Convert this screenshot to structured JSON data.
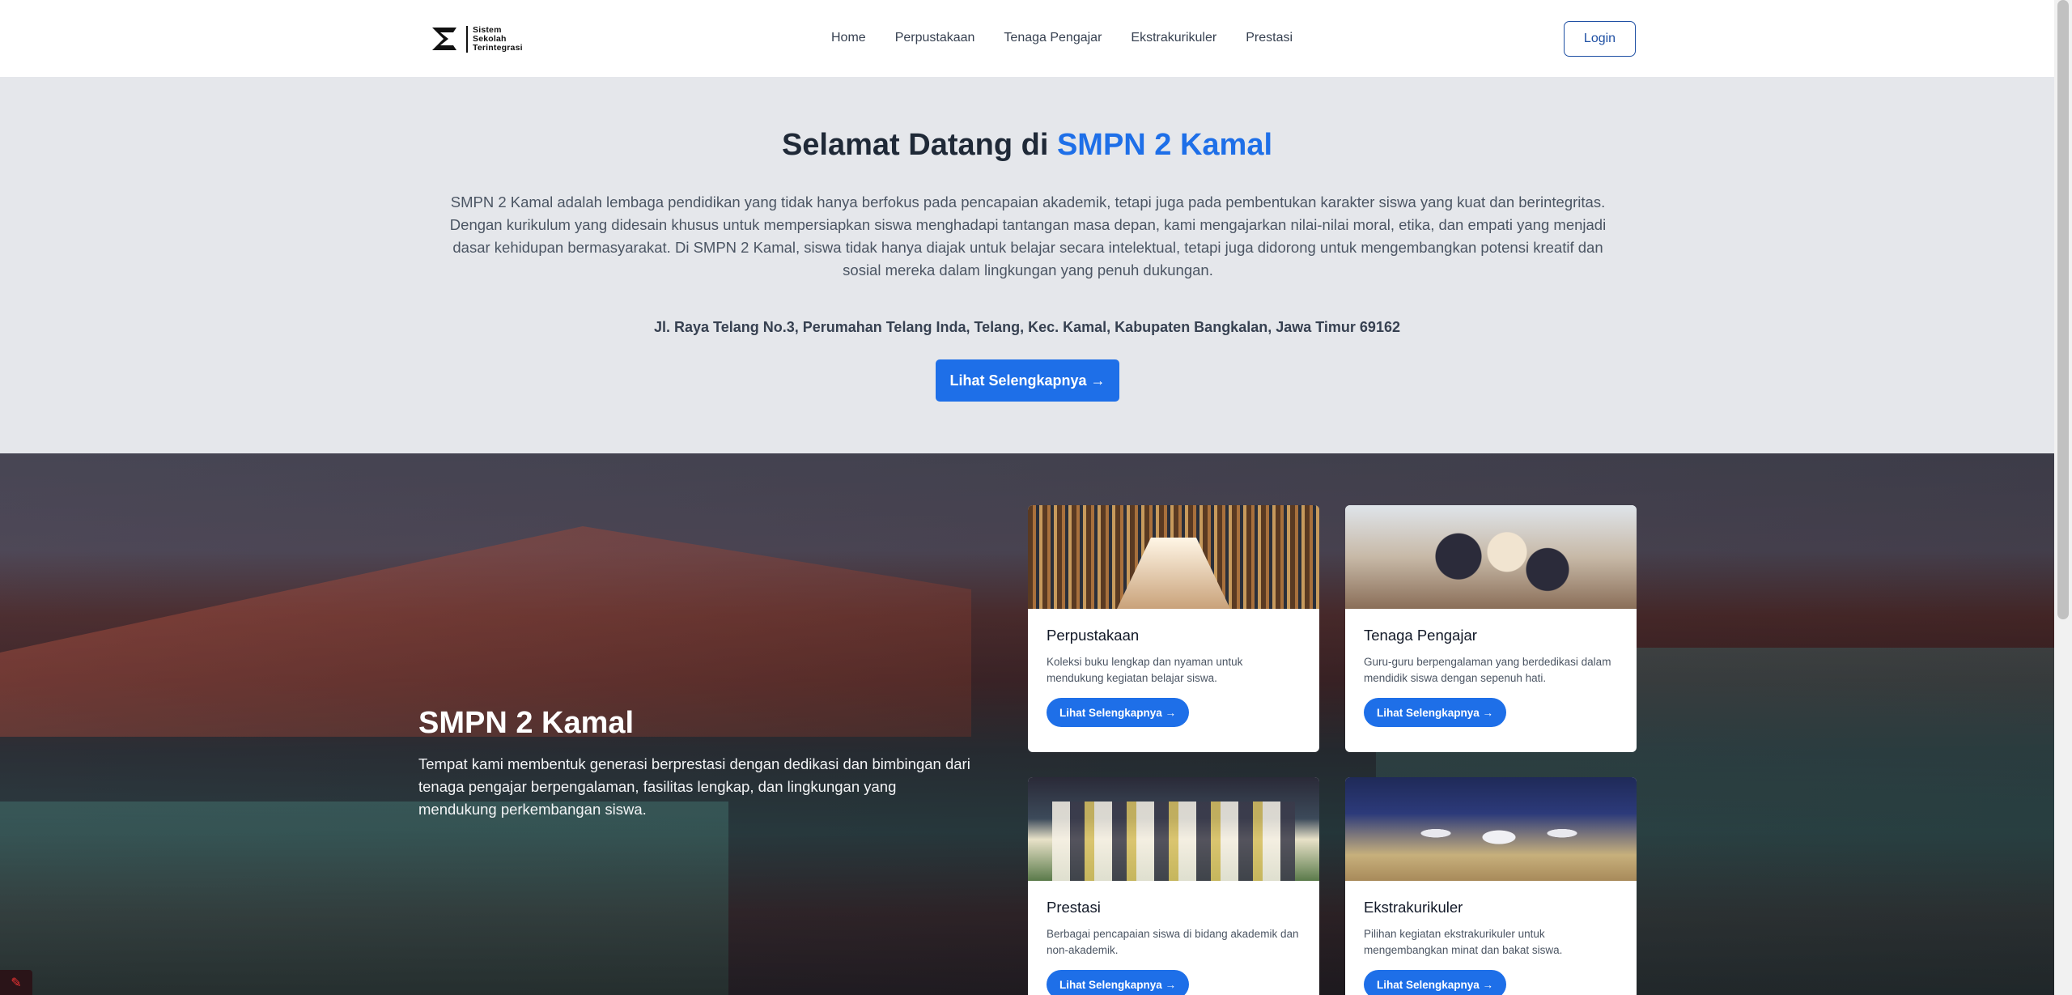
{
  "logo": {
    "line1": "Sistem",
    "line2": "Sekolah",
    "line3": "Terintegrasi"
  },
  "nav": {
    "items": [
      {
        "label": "Home"
      },
      {
        "label": "Perpustakaan"
      },
      {
        "label": "Tenaga Pengajar"
      },
      {
        "label": "Ekstrakurikuler"
      },
      {
        "label": "Prestasi"
      }
    ],
    "login_label": "Login"
  },
  "hero": {
    "title_prefix": "Selamat Datang di ",
    "title_accent": "SMPN 2 Kamal",
    "description": "SMPN 2 Kamal adalah lembaga pendidikan yang tidak hanya berfokus pada pencapaian akademik, tetapi juga pada pembentukan karakter siswa yang kuat dan berintegritas. Dengan kurikulum yang didesain khusus untuk mempersiapkan siswa menghadapi tantangan masa depan, kami mengajarkan nilai-nilai moral, etika, dan empati yang menjadi dasar kehidupan bermasyarakat. Di SMPN 2 Kamal, siswa tidak hanya diajak untuk belajar secara intelektual, tetapi juga didorong untuk mengembangkan potensi kreatif dan sosial mereka dalam lingkungan yang penuh dukungan.",
    "address": "Jl. Raya Telang No.3, Perumahan Telang Inda, Telang, Kec. Kamal, Kabupaten Bangkalan, Jawa Timur 69162",
    "button_label": "Lihat Selengkapnya →"
  },
  "feature": {
    "title": "SMPN 2 Kamal",
    "description": "Tempat kami membentuk generasi berprestasi dengan dedikasi dan bimbingan dari tenaga pengajar berpengalaman, fasilitas lengkap, dan lingkungan yang mendukung perkembangan siswa."
  },
  "cards": [
    {
      "title": "Perpustakaan",
      "description": "Koleksi buku lengkap dan nyaman untuk mendukung kegiatan belajar siswa.",
      "button_label": "Lihat Selengkapnya →"
    },
    {
      "title": "Tenaga Pengajar",
      "description": "Guru-guru berpengalaman yang berdedikasi dalam mendidik siswa dengan sepenuh hati.",
      "button_label": "Lihat Selengkapnya →"
    },
    {
      "title": "Prestasi",
      "description": "Berbagai pencapaian siswa di bidang akademik dan non-akademik.",
      "button_label": "Lihat Selengkapnya →"
    },
    {
      "title": "Ekstrakurikuler",
      "description": "Pilihan kegiatan ekstrakurikuler untuk mengembangkan minat dan bakat siswa.",
      "button_label": "Lihat Selengkapnya →"
    }
  ],
  "colors": {
    "accent": "#1e6fe8",
    "login_border": "#1e4fa3",
    "hero_bg": "#e5e7eb"
  }
}
